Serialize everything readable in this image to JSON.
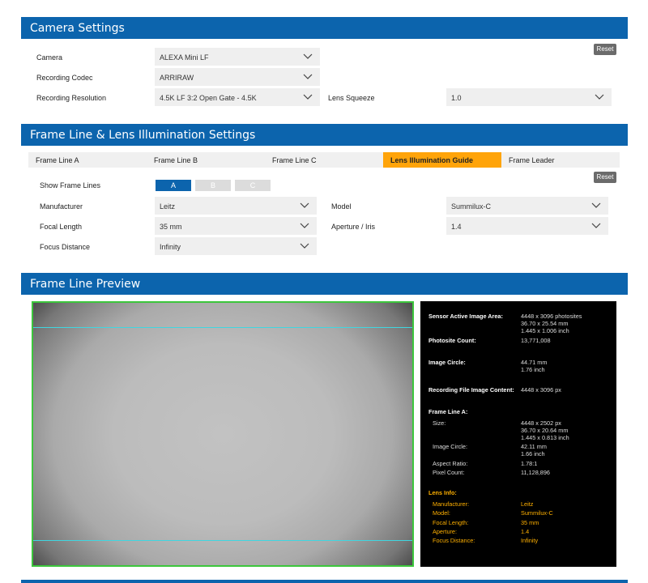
{
  "camera_settings": {
    "title": "Camera Settings",
    "reset_label": "Reset",
    "camera_label": "Camera",
    "camera_value": "ALEXA Mini LF",
    "codec_label": "Recording Codec",
    "codec_value": "ARRIRAW",
    "resolution_label": "Recording Resolution",
    "resolution_value": "4.5K LF 3:2 Open Gate - 4.5K",
    "squeeze_label": "Lens Squeeze",
    "squeeze_value": "1.0"
  },
  "frame_settings": {
    "title": "Frame Line & Lens Illumination Settings",
    "tabs": [
      {
        "label": "Frame Line A"
      },
      {
        "label": "Frame Line B"
      },
      {
        "label": "Frame Line C"
      },
      {
        "label": "Lens Illumination Guide"
      },
      {
        "label": "Frame Leader"
      }
    ],
    "reset_label": "Reset",
    "show_lines_label": "Show Frame Lines",
    "line_buttons": [
      "A",
      "B",
      "C"
    ],
    "manufacturer_label": "Manufacturer",
    "manufacturer_value": "Leitz",
    "model_label": "Model",
    "model_value": "Summilux-C",
    "focal_label": "Focal Length",
    "focal_value": "35 mm",
    "aperture_label": "Aperture / Iris",
    "aperture_value": "1.4",
    "focus_label": "Focus Distance",
    "focus_value": "Infinity"
  },
  "preview": {
    "title": "Frame Line Preview",
    "sensor_label": "Sensor Active Image Area:",
    "sensor_values": [
      "4448 x 3096 photosites",
      "36.70 x 25.54 mm",
      "1.445 x 1.006 inch"
    ],
    "photosite_label": "Photosite Count:",
    "photosite_value": "13,771,008",
    "circle_label": "Image Circle:",
    "circle_values": [
      "44.71 mm",
      "1.76 inch"
    ],
    "recording_label": "Recording File Image Content:",
    "recording_value": "4448 x 3096 px",
    "frame_a_label": "Frame Line A:",
    "size_label": "Size:",
    "size_values": [
      "4448 x 2502 px",
      "36.70 x 20.64 mm",
      "1.445 x 0.813 inch"
    ],
    "fa_circle_label": "Image Circle:",
    "fa_circle_values": [
      "42.11 mm",
      "1.66 inch"
    ],
    "aspect_label": "Aspect Ratio:",
    "aspect_value": "1.78:1",
    "pixel_label": "Pixel Count:",
    "pixel_value": "11,128,896",
    "lens_info_label": "Lens Info:",
    "lens_manufacturer_label": "Manufacturer:",
    "lens_manufacturer_value": "Leitz",
    "lens_model_label": "Model:",
    "lens_model_value": "Summilux-C",
    "lens_focal_label": "Focal Length:",
    "lens_focal_value": "35 mm",
    "lens_aperture_label": "Aperture:",
    "lens_aperture_value": "1.4",
    "lens_focus_label": "Focus Distance:",
    "lens_focus_value": "Infinity"
  },
  "colors": {
    "header_blue": "#0c64ad",
    "active_tab": "#ffa40a",
    "frame_line_a": "#3fd6e0",
    "sensor_border": "#3cc63c",
    "lens_info": "#ffb000"
  },
  "icons": {
    "dropdown": "chevron-down-icon"
  }
}
